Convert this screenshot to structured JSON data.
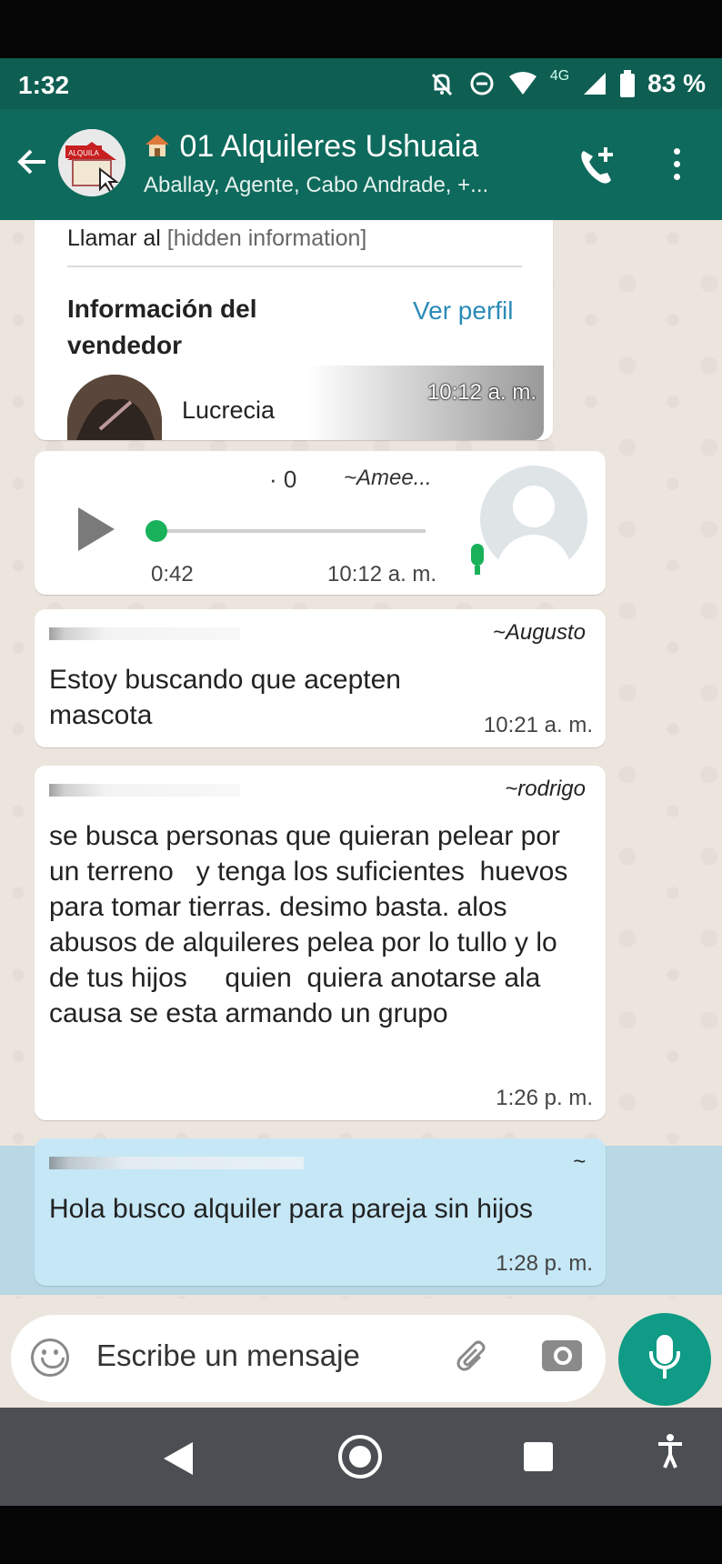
{
  "status_bar": {
    "time": "1:32",
    "network": "4G",
    "battery": "83 %"
  },
  "header": {
    "title": "01 Alquileres Ushuaia",
    "subtitle": "Aballay, Agente, Cabo Andrade, +...",
    "avatar_sign": "ALQUILA"
  },
  "messages": {
    "contact_card": {
      "call_label": "Llamar al",
      "call_hidden": "[hidden information]",
      "seller_info": "Información del vendedor",
      "view_profile": "Ver perfil",
      "seller_name": "Lucrecia",
      "time": "10:12 a. m."
    },
    "voice_note": {
      "marker": "· 0",
      "sender": "~Amee...",
      "duration": "0:42",
      "time": "10:12 a. m."
    },
    "msg1": {
      "sender": "~Augusto",
      "text": "Estoy buscando que acepten mascota",
      "time": "10:21 a. m."
    },
    "msg2": {
      "sender": "~rodrigo",
      "text": "se busca personas que quieran pelear por un terreno   y tenga los suficientes  huevos para tomar tierras. desimo basta. alos abusos de alquileres pelea por lo tullo y lo de tus hijos     quien  quiera anotarse ala causa se esta armando un grupo",
      "time": "1:26 p. m."
    },
    "msg3": {
      "sender": "~",
      "text": "Hola busco alquiler para pareja sin hijos",
      "time": "1:28 p. m."
    }
  },
  "input": {
    "placeholder": "Escribe un mensaje"
  },
  "colors": {
    "header": "#0e6a5c",
    "status": "#0e5e52",
    "chat_bg": "#ece5dd",
    "highlight": "#c5e7f6",
    "accent_green": "#0f9b85"
  }
}
